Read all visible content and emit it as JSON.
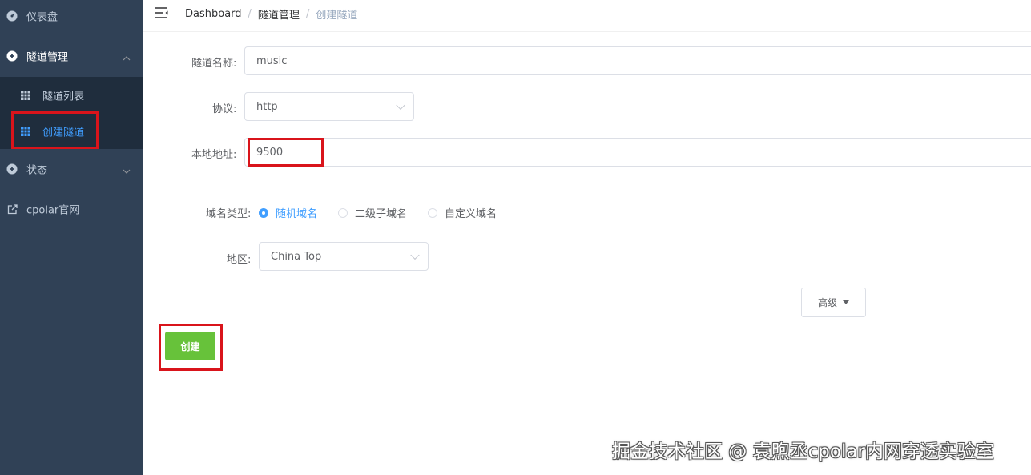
{
  "sidebar": {
    "dashboard": "仪表盘",
    "tunnel_mgmt": "隧道管理",
    "tunnel_list": "隧道列表",
    "create_tunnel": "创建隧道",
    "status": "状态",
    "official_site": "cpolar官网"
  },
  "breadcrumb": [
    "Dashboard",
    "隧道管理",
    "创建隧道"
  ],
  "form": {
    "name_label": "隧道名称:",
    "name_value": "music",
    "protocol_label": "协议:",
    "protocol_value": "http",
    "local_addr_label": "本地地址:",
    "local_addr_value": "9500",
    "domain_type_label": "域名类型:",
    "domain_types": [
      "随机域名",
      "二级子域名",
      "自定义域名"
    ],
    "domain_type_selected": "随机域名",
    "region_label": "地区:",
    "region_value": "China Top",
    "advanced_label": "高级",
    "create_label": "创建"
  },
  "watermark": "掘金技术社区 @ 袁煦丞cpolar内网穿透实验室",
  "colors": {
    "sidebar_bg": "#304156",
    "submenu_bg": "#1f2d3d",
    "active": "#409eff",
    "create_button": "#67c23a",
    "highlight_box": "#d9141b"
  }
}
